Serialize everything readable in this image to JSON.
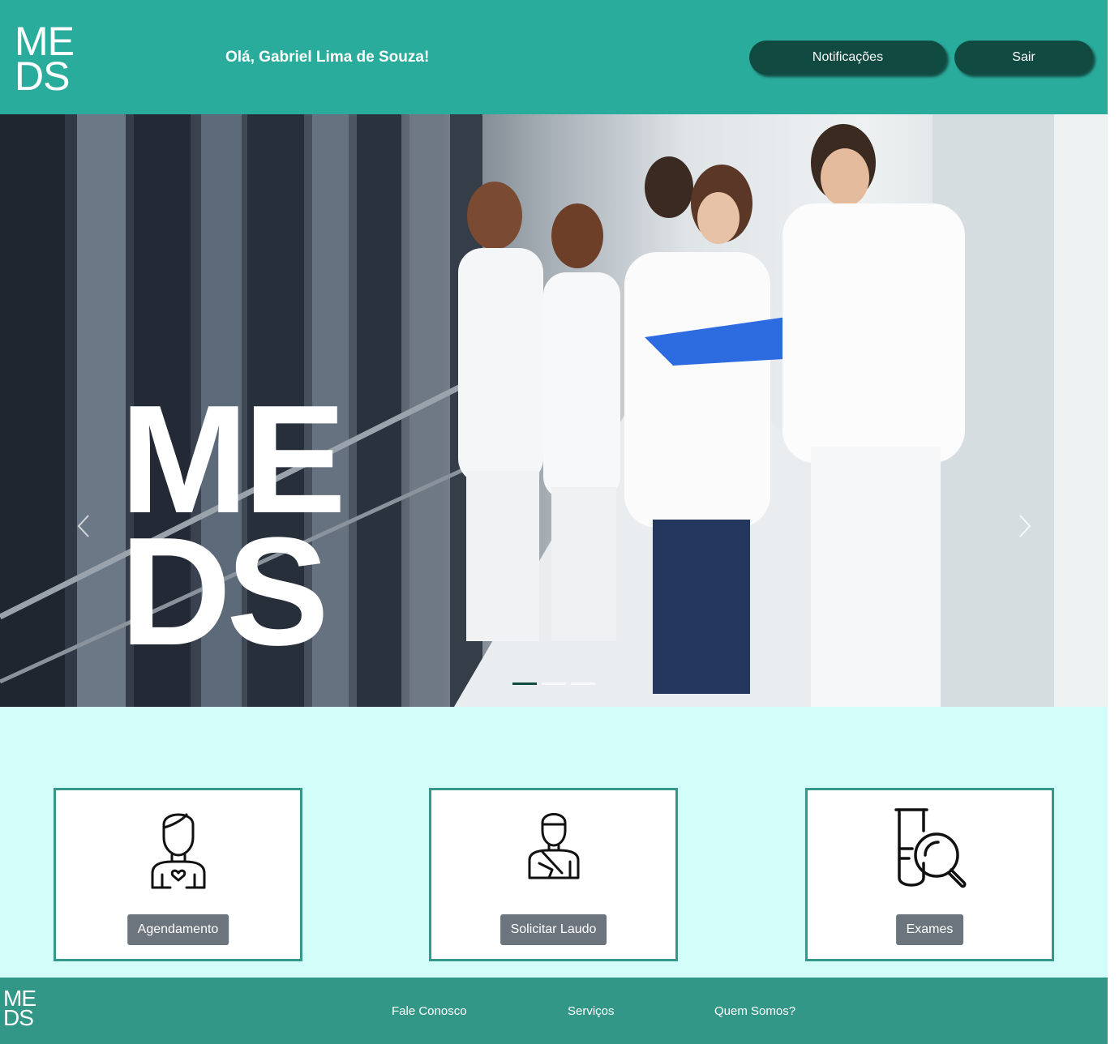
{
  "header": {
    "logo_line1": "ME",
    "logo_line2": "DS",
    "greeting": "Olá, Gabriel Lima de Souza!",
    "notifications_label": "Notificações",
    "logout_label": "Sair"
  },
  "hero": {
    "logo_line1": "ME",
    "logo_line2": "DS",
    "slide_count": 3,
    "active_slide": 1,
    "photo_description_icon": "medical-team-photo"
  },
  "services": {
    "cards": [
      {
        "icon": "patient-heart-icon",
        "label": "Agendamento"
      },
      {
        "icon": "injured-patient-icon",
        "label": "Solicitar Laudo"
      },
      {
        "icon": "test-tube-magnifier-icon",
        "label": "Exames"
      }
    ]
  },
  "footer": {
    "logo_line1": "ME",
    "logo_line2": "DS",
    "links": [
      "Fale Conosco",
      "Serviços",
      "Quem Somos?"
    ]
  },
  "colors": {
    "header_bg": "#2aac9c",
    "button_dark": "#114a40",
    "services_bg": "#d3fdf8",
    "card_border": "#34988a",
    "card_button": "#6c757d",
    "footer_bg": "#339788"
  }
}
